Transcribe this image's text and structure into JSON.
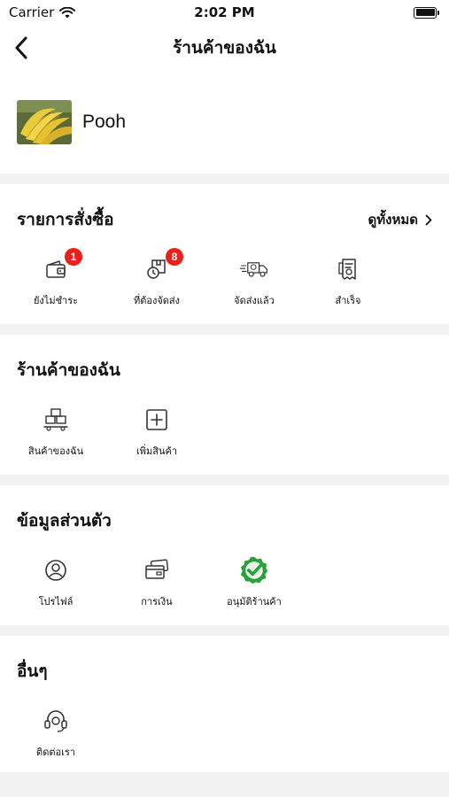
{
  "status_bar": {
    "carrier": "Carrier",
    "time": "2:02 PM"
  },
  "nav": {
    "title": "ร้านค้าของฉัน"
  },
  "profile": {
    "name": "Pooh"
  },
  "orders": {
    "title": "รายการสั่งซื้อ",
    "view_all": "ดูทั้งหมด",
    "items": [
      {
        "label": "ยังไม่ชำระ",
        "icon": "wallet-icon",
        "badge": "1"
      },
      {
        "label": "ที่ต้องจัดส่ง",
        "icon": "package-clock-icon",
        "badge": "8"
      },
      {
        "label": "จัดส่งแล้ว",
        "icon": "delivery-truck-icon"
      },
      {
        "label": "สำเร็จ",
        "icon": "receipt-icon"
      }
    ]
  },
  "my_shop": {
    "title": "ร้านค้าของฉัน",
    "items": [
      {
        "label": "สินค้าของฉัน",
        "icon": "boxes-icon"
      },
      {
        "label": "เพิ่มสินค้า",
        "icon": "add-square-icon"
      }
    ]
  },
  "personal": {
    "title": "ข้อมูลส่วนตัว",
    "items": [
      {
        "label": "โปรไฟล์",
        "icon": "user-circle-icon"
      },
      {
        "label": "การเงิน",
        "icon": "cards-icon"
      },
      {
        "label": "อนุมัติร้านค้า",
        "icon": "verified-check-icon"
      }
    ]
  },
  "others": {
    "title": "อื่นๆ",
    "items": [
      {
        "label": "ติดต่อเรา",
        "icon": "headset-icon"
      }
    ]
  },
  "colors": {
    "badge": "#e8211a",
    "verified": "#2aa03a",
    "background": "#f2f2f2"
  }
}
